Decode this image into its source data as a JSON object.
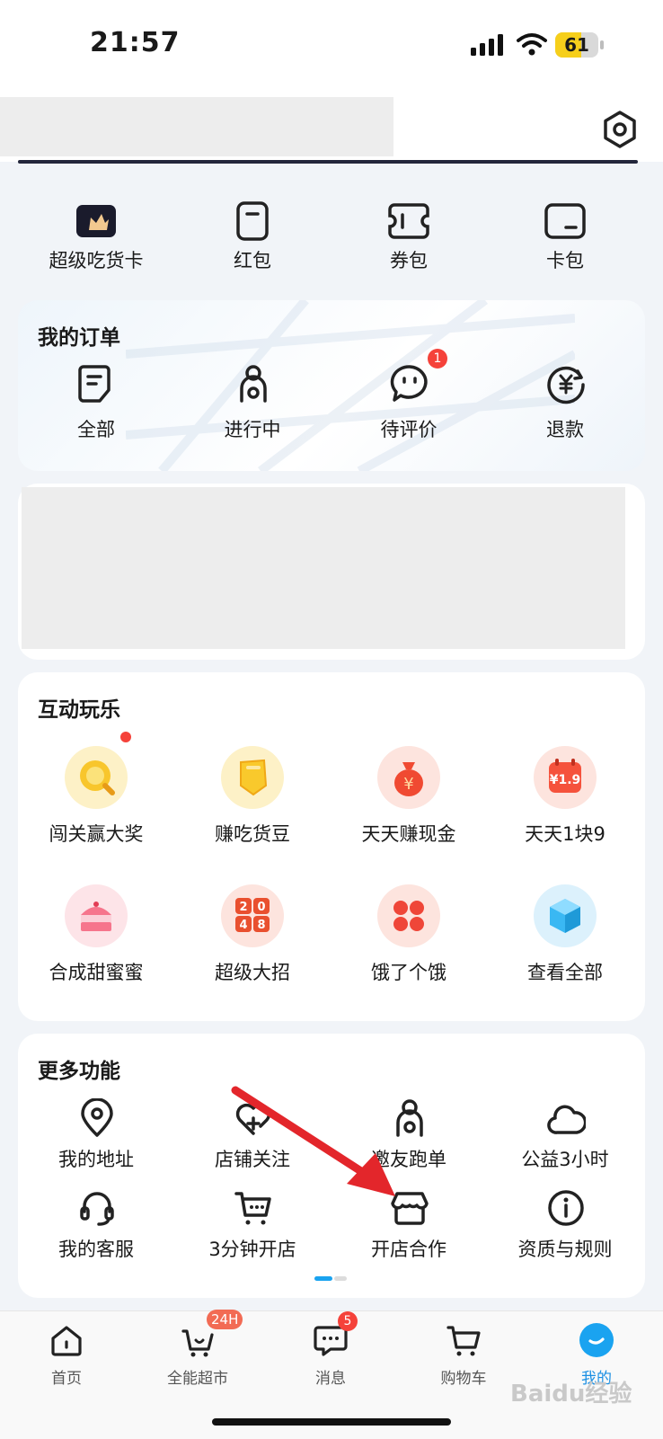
{
  "status_bar": {
    "time": "21:57",
    "battery": "61",
    "battery_level": 0.61
  },
  "assets": [
    {
      "label": "超级吃货卡",
      "icon": "crown-card-icon"
    },
    {
      "label": "红包",
      "icon": "red-envelope-icon"
    },
    {
      "label": "券包",
      "icon": "coupon-icon"
    },
    {
      "label": "卡包",
      "icon": "card-wallet-icon"
    }
  ],
  "orders": {
    "title": "我的订单",
    "items": [
      {
        "label": "全部",
        "icon": "document-icon"
      },
      {
        "label": "进行中",
        "icon": "rider-icon"
      },
      {
        "label": "待评价",
        "icon": "chat-bubble-icon",
        "badge": "1"
      },
      {
        "label": "退款",
        "icon": "refund-icon"
      }
    ]
  },
  "play": {
    "title": "互动玩乐",
    "items": [
      {
        "label": "闯关赢大奖",
        "icon": "magnifier-coin-icon",
        "color": "#f8c62c"
      },
      {
        "label": "赚吃货豆",
        "icon": "bean-icon",
        "color": "#f9c92c"
      },
      {
        "label": "天天赚现金",
        "icon": "money-bag-icon",
        "color": "#f04a32"
      },
      {
        "label": "天天1块9",
        "icon": "calendar-deal-icon",
        "color": "#f5523c"
      },
      {
        "label": "合成甜蜜蜜",
        "icon": "cake-icon",
        "color": "#f6758c"
      },
      {
        "label": "超级大招",
        "icon": "game-2048-icon",
        "color": "#e9502f"
      },
      {
        "label": "饿了个饿",
        "icon": "match-game-icon",
        "color": "#ef4638"
      },
      {
        "label": "查看全部",
        "icon": "cube-icon",
        "color": "#3ab8f3"
      }
    ]
  },
  "more": {
    "title": "更多功能",
    "items": [
      {
        "label": "我的地址",
        "icon": "location-pin-icon"
      },
      {
        "label": "店铺关注",
        "icon": "heart-plus-icon"
      },
      {
        "label": "邀友跑单",
        "icon": "rider-icon"
      },
      {
        "label": "公益3小时",
        "icon": "cloud-icon"
      },
      {
        "label": "我的客服",
        "icon": "headset-icon"
      },
      {
        "label": "3分钟开店",
        "icon": "cart-chat-icon"
      },
      {
        "label": "开店合作",
        "icon": "storefront-icon"
      },
      {
        "label": "资质与规则",
        "icon": "info-icon"
      }
    ]
  },
  "tabbar": {
    "items": [
      {
        "label": "首页",
        "icon": "home-icon"
      },
      {
        "label": "全能超市",
        "icon": "basket-icon",
        "badge": "24H"
      },
      {
        "label": "消息",
        "icon": "message-icon",
        "badge": "5"
      },
      {
        "label": "购物车",
        "icon": "shopping-cart-icon"
      },
      {
        "label": "我的",
        "icon": "profile-icon",
        "active": true
      }
    ]
  },
  "watermark": "Baidu经验"
}
